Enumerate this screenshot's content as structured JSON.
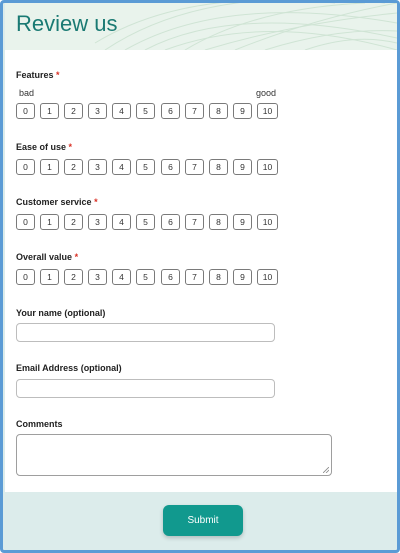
{
  "header": {
    "title": "Review us"
  },
  "ratings": [
    {
      "label": "Features",
      "required_mark": "*",
      "low_label": "bad",
      "high_label": "good"
    },
    {
      "label": "Ease of use",
      "required_mark": "*"
    },
    {
      "label": "Customer service",
      "required_mark": "*"
    },
    {
      "label": "Overall value",
      "required_mark": "*"
    }
  ],
  "scale_options": [
    "0",
    "1",
    "2",
    "3",
    "4",
    "5",
    "6",
    "7",
    "8",
    "9",
    "10"
  ],
  "fields": {
    "name_label": "Your name (optional)",
    "name_value": "",
    "email_label": "Email Address (optional)",
    "email_value": "",
    "comments_label": "Comments",
    "comments_value": ""
  },
  "submit_label": "Submit",
  "colors": {
    "accent": "#11998e",
    "title": "#1a7a73",
    "required": "#d93025",
    "frame_border": "#5b9bd5"
  }
}
